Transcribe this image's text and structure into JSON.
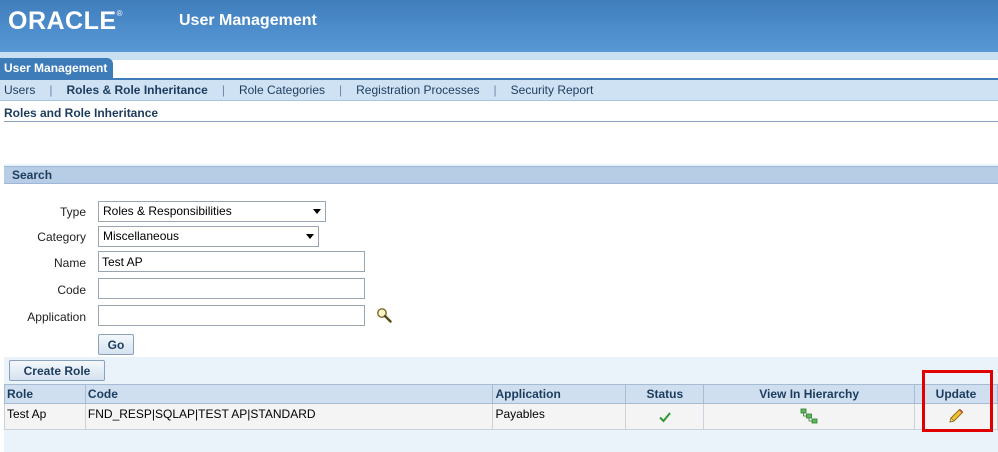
{
  "header": {
    "logo_text": "ORACLE",
    "logo_mark": "®",
    "app_title": "User Management"
  },
  "tab": {
    "label": "User Management"
  },
  "subnav": {
    "items": [
      {
        "label": "Users",
        "active": false
      },
      {
        "label": "Roles & Role Inheritance",
        "active": true
      },
      {
        "label": "Role Categories",
        "active": false
      },
      {
        "label": "Registration Processes",
        "active": false
      },
      {
        "label": "Security Report",
        "active": false
      }
    ],
    "separator": "|"
  },
  "page": {
    "title": "Roles and Role Inheritance"
  },
  "search": {
    "heading": "Search",
    "type": {
      "label": "Type",
      "value": "Roles & Responsibilities"
    },
    "category": {
      "label": "Category",
      "value": "Miscellaneous"
    },
    "name": {
      "label": "Name",
      "value": "Test AP"
    },
    "code": {
      "label": "Code",
      "value": ""
    },
    "application": {
      "label": "Application",
      "value": ""
    },
    "go_label": "Go"
  },
  "results": {
    "create_label": "Create Role",
    "columns": [
      "Role",
      "Code",
      "Application",
      "Status",
      "View In Hierarchy",
      "Update"
    ],
    "rows": [
      {
        "role": "Test Ap",
        "code": "FND_RESP|SQLAP|TEST AP|STANDARD",
        "application": "Payables",
        "status_icon": "checkmark-icon",
        "hierarchy_icon": "hierarchy-icon",
        "update_icon": "pencil-icon"
      }
    ]
  },
  "colors": {
    "header_blue": "#4d8ccb",
    "nav_bg": "#cfe2f3",
    "highlight_red": "#e00000",
    "status_green": "#2f9a2f"
  }
}
